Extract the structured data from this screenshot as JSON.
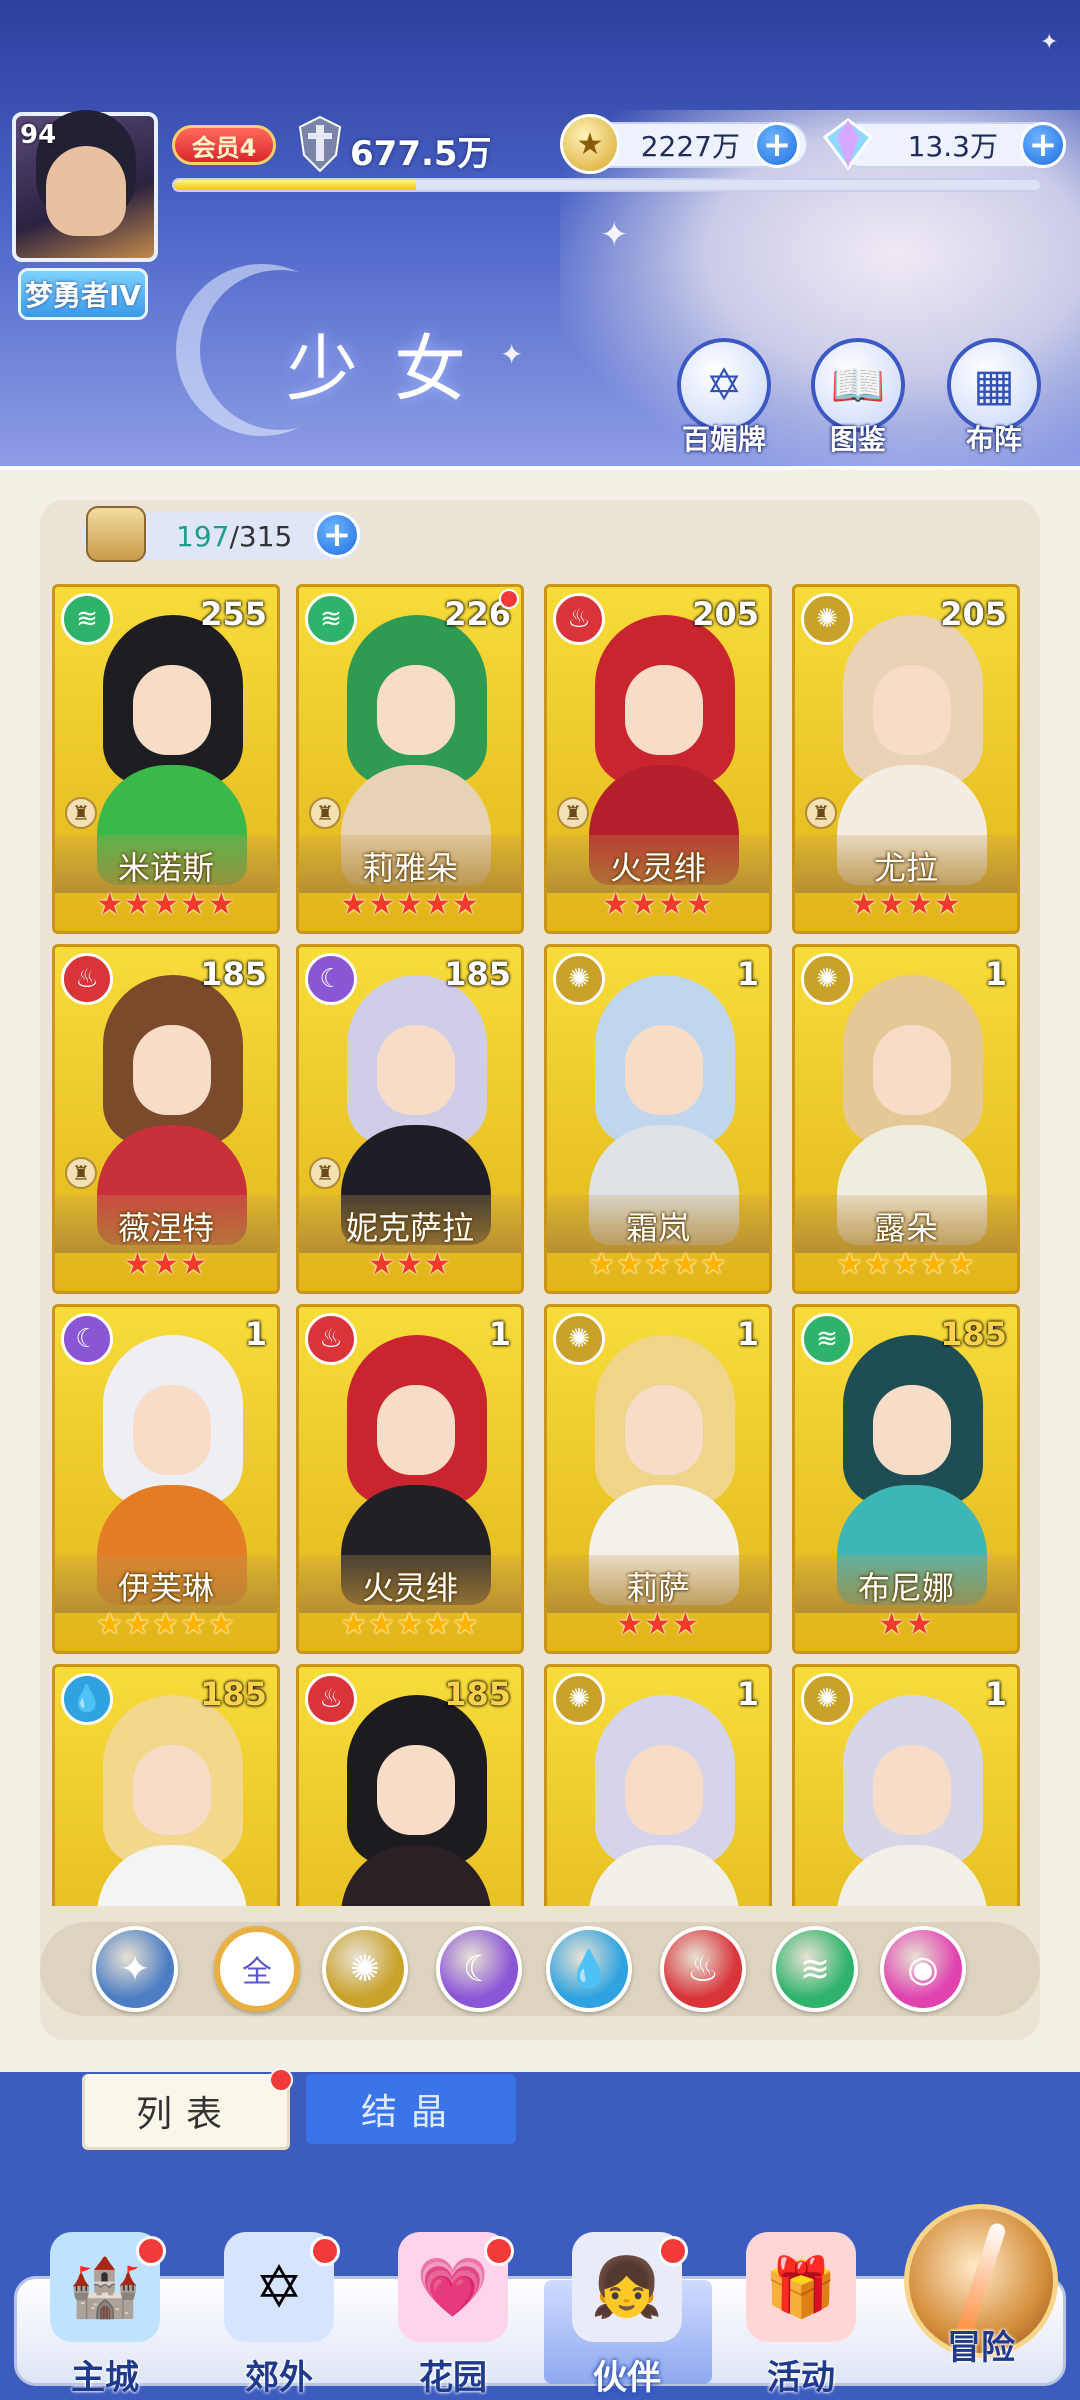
{
  "player": {
    "level": "94",
    "rank": "梦勇者IV",
    "vip": "会员4",
    "power": "677.5万",
    "exp_progress": 0.28
  },
  "resources": {
    "gold": "2227万",
    "diamond": "13.3万"
  },
  "page": {
    "title": "少女",
    "buttons": [
      "百媚牌",
      "图鉴",
      "布阵"
    ]
  },
  "inventory": {
    "current": "197",
    "separator": "/",
    "max": "315"
  },
  "colors": {
    "wind": "#2fb36a",
    "fire": "#d8343a",
    "light": "#c9a22a",
    "dark": "#8b56d6",
    "water": "#2ea3df",
    "pink": "#e043b0",
    "air": "#4d7ec4"
  },
  "cards": [
    {
      "name": "米诺斯",
      "level": "255",
      "element": "wind",
      "stars": 5,
      "star_color": "red",
      "red_dot": false,
      "chess": true,
      "hair": "#1d1d22",
      "body": "#3bb84a"
    },
    {
      "name": "莉雅朵",
      "level": "226",
      "element": "wind",
      "stars": 5,
      "star_color": "red",
      "red_dot": true,
      "chess": true,
      "hair": "#2f9a52",
      "body": "#e8d2b4"
    },
    {
      "name": "火灵绯",
      "level": "205",
      "element": "fire",
      "stars": 4,
      "star_color": "red",
      "red_dot": false,
      "chess": true,
      "hair": "#c8252f",
      "body": "#b41f2c"
    },
    {
      "name": "尤拉",
      "level": "205",
      "element": "light",
      "stars": 4,
      "star_color": "red",
      "red_dot": false,
      "chess": true,
      "hair": "#e9d2b6",
      "body": "#f3ece2"
    },
    {
      "name": "薇涅特",
      "level": "185",
      "element": "fire",
      "stars": 3,
      "star_color": "red",
      "red_dot": false,
      "chess": true,
      "hair": "#7a4a2a",
      "body": "#c8303a"
    },
    {
      "name": "妮克萨拉",
      "level": "185",
      "element": "dark",
      "stars": 3,
      "star_color": "red",
      "red_dot": false,
      "chess": true,
      "hair": "#cfcde8",
      "body": "#1e1e26"
    },
    {
      "name": "霜岚",
      "level": "1",
      "element": "light",
      "stars": 5,
      "star_color": "gold",
      "red_dot": false,
      "chess": false,
      "hair": "#bfd6ee",
      "body": "#dfe3e8"
    },
    {
      "name": "露朵",
      "level": "1",
      "element": "light",
      "stars": 5,
      "star_color": "gold",
      "red_dot": false,
      "chess": false,
      "hair": "#e6c796",
      "body": "#f1ece0"
    },
    {
      "name": "伊芙琳",
      "level": "1",
      "element": "dark",
      "stars": 5,
      "star_color": "gold",
      "red_dot": false,
      "chess": false,
      "hair": "#eeeef4",
      "body": "#e37c24"
    },
    {
      "name": "火灵绯",
      "level": "1",
      "element": "fire",
      "stars": 5,
      "star_color": "gold",
      "red_dot": false,
      "chess": false,
      "hair": "#c8252f",
      "body": "#222026"
    },
    {
      "name": "莉萨",
      "level": "1",
      "element": "light",
      "stars": 3,
      "star_color": "red",
      "red_dot": false,
      "chess": false,
      "hair": "#f0d48a",
      "body": "#f4f0ea"
    },
    {
      "name": "布尼娜",
      "level": "185",
      "element": "wind",
      "stars": 2,
      "star_color": "red",
      "red_dot": false,
      "chess": false,
      "hair": "#1e4e54",
      "body": "#3fb6b6"
    },
    {
      "name": "",
      "level": "185",
      "element": "water",
      "stars": 0,
      "star_color": "red",
      "red_dot": false,
      "chess": false,
      "hair": "#f2d78c",
      "body": "#f4f4f4"
    },
    {
      "name": "",
      "level": "185",
      "element": "fire",
      "stars": 0,
      "star_color": "red",
      "red_dot": false,
      "chess": false,
      "hair": "#1b1b20",
      "body": "#2a2026"
    },
    {
      "name": "",
      "level": "1",
      "element": "light",
      "stars": 0,
      "star_color": "red",
      "red_dot": false,
      "chess": false,
      "hair": "#d6d4ec",
      "body": "#f2efe8"
    },
    {
      "name": "",
      "level": "1",
      "element": "light",
      "stars": 0,
      "star_color": "red",
      "red_dot": false,
      "chess": false,
      "hair": "#d6d6e8",
      "body": "#f3efe6"
    }
  ],
  "filters": [
    {
      "key": "air",
      "label": ""
    },
    {
      "key": "all",
      "label": "全"
    },
    {
      "key": "light",
      "label": ""
    },
    {
      "key": "dark",
      "label": ""
    },
    {
      "key": "water",
      "label": ""
    },
    {
      "key": "fire",
      "label": ""
    },
    {
      "key": "wind",
      "label": ""
    },
    {
      "key": "pink",
      "label": ""
    }
  ],
  "tabs": {
    "list": "列表",
    "crystal": "结晶"
  },
  "nav": [
    {
      "label": "主城",
      "icon": "castle-icon",
      "red_dot": true
    },
    {
      "label": "郊外",
      "icon": "portal-icon",
      "red_dot": true
    },
    {
      "label": "花园",
      "icon": "heart-icon",
      "red_dot": true
    },
    {
      "label": "伙伴",
      "icon": "partner-icon",
      "red_dot": true
    },
    {
      "label": "活动",
      "icon": "gift-icon",
      "red_dot": false
    }
  ],
  "adventure_label": "冒险"
}
